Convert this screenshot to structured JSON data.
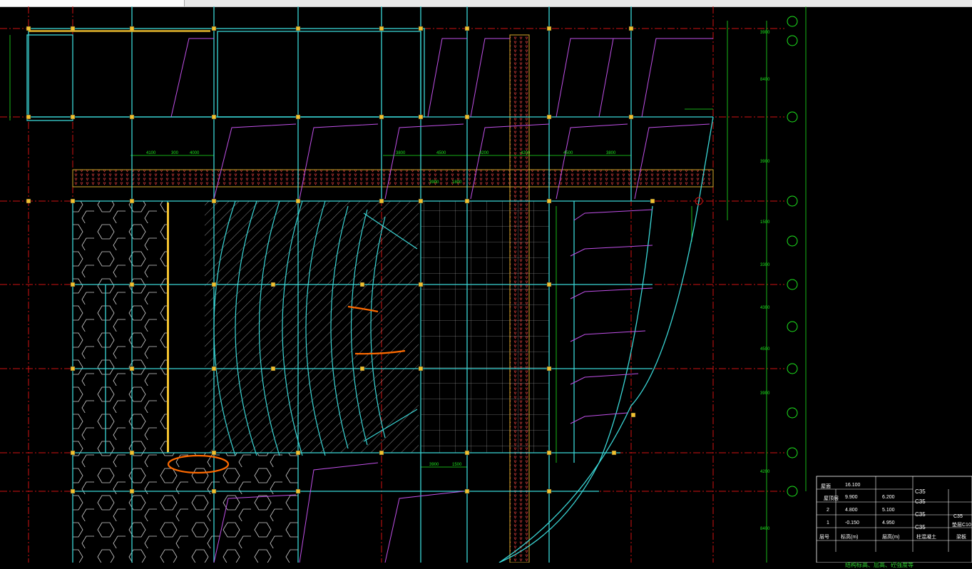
{
  "window": {
    "tab_label": ""
  },
  "axes": [
    {
      "id": "1/D",
      "label": ""
    },
    {
      "id": "D",
      "label": ""
    },
    {
      "id": "C",
      "label": ""
    },
    {
      "id": "B",
      "label": ""
    },
    {
      "id": "A",
      "label": ""
    }
  ],
  "dims": {
    "top": [
      "4100",
      "300",
      "4000",
      "3800",
      "4500",
      "4200",
      "4200",
      "4500",
      "3800"
    ],
    "mid": [
      "3900",
      "1800"
    ],
    "bottom": [
      "3900",
      "1500"
    ],
    "right": [
      "3900",
      "8400",
      "3900",
      "1500",
      "3300",
      "4300",
      "4500",
      "3900",
      "4200",
      "8400"
    ]
  },
  "legend": {
    "roof_label": "屋面",
    "roof_height": "16.100",
    "rows": [
      {
        "floor": "2",
        "name": "屋顶层",
        "elev": "9.900",
        "height": "6.200",
        "grade": "C35"
      },
      {
        "floor": "2",
        "name": "",
        "elev": "4.800",
        "height": "5.100",
        "grade": "C35"
      },
      {
        "floor": "1",
        "name": "",
        "elev": "-0.150",
        "height": "4.950",
        "grade": "C35"
      }
    ],
    "header": {
      "floor": "层号",
      "name": "层楼号",
      "elev": "标高(m)",
      "height": "层高(m)",
      "col": "柱混凝土",
      "slab": "梁板"
    },
    "side_grade": "C35",
    "side_note": "垫层C10",
    "caption": "结构标高、层高、砼强度等"
  },
  "colors": {
    "background": "#000000",
    "axis_green": "#1ee61e",
    "grid_red": "#d01212",
    "wall_cyan": "#3ad6d6",
    "column_yellow": "#f2c230",
    "annotation_orange": "#ff6a00",
    "roof_magenta": "#c050e8"
  }
}
